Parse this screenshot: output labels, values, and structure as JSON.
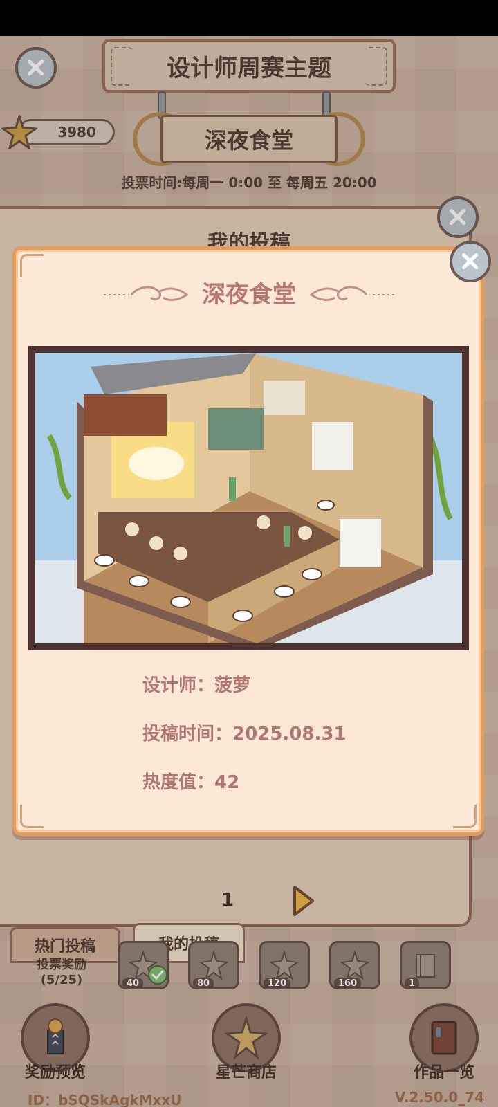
{
  "header": {
    "title": "设计师周赛主题",
    "theme_name": "深夜食堂",
    "vote_time": "投票时间:每周一 0:00 至 每周五 20:00",
    "star_count": "3980"
  },
  "submissions_panel": {
    "title": "我的投稿",
    "page_number": "1"
  },
  "tabs": {
    "hot": "热门投稿",
    "mine": "我的投稿"
  },
  "vote_rewards": {
    "label_line1": "投票奖励",
    "label_line2": "(5/25)",
    "slots": [
      {
        "count": "40",
        "claimed": true
      },
      {
        "count": "80",
        "claimed": false
      },
      {
        "count": "120",
        "claimed": false
      },
      {
        "count": "160",
        "claimed": false
      },
      {
        "count": "1",
        "claimed": false
      }
    ]
  },
  "bottom_nav": {
    "reward_preview": "奖励预览",
    "star_shop": "星芒商店",
    "works_list": "作品一览"
  },
  "footer": {
    "user_id": "ID：bSQSkAgkMxxU",
    "version": "V.2.50.0_74"
  },
  "modal": {
    "title": "深夜食堂",
    "designer_label": "设计师：",
    "designer_value": "菠萝",
    "submit_time_label": "投稿时间：",
    "submit_time_value": "2025.08.31",
    "heat_label": "热度值：",
    "heat_value": "42"
  },
  "colors": {
    "modal_bg": "#fbe8d6",
    "modal_border": "#e29d5c",
    "modal_text": "#b07870",
    "dark_text": "#4e3c33"
  },
  "icons": {
    "close": "close-icon",
    "star": "star-icon",
    "next": "next-arrow-icon",
    "check": "check-icon",
    "book": "book-icon",
    "trophy": "trophy-icon"
  }
}
